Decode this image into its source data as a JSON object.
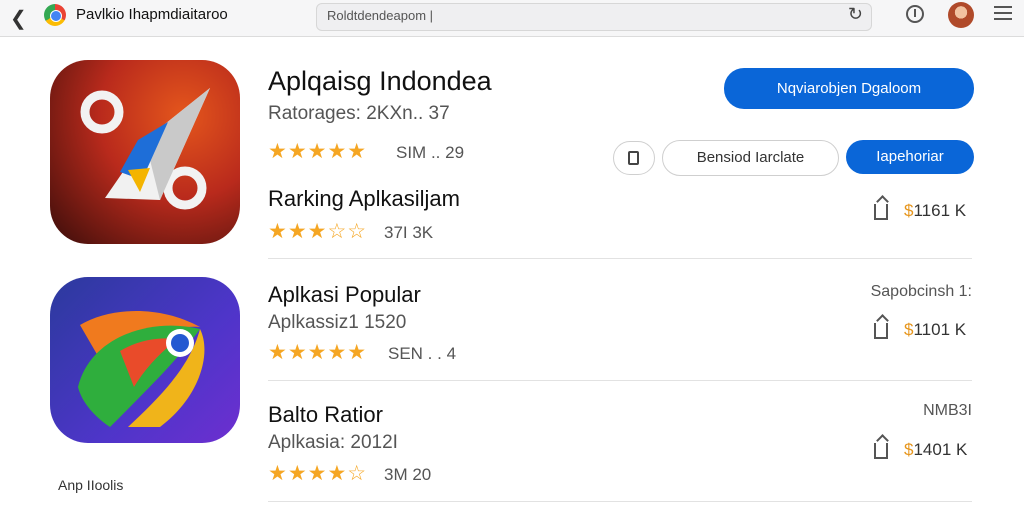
{
  "browser": {
    "back_icon": "chevron-left-icon",
    "tab_title": "Pavlkio Ihapmdiaitaroo",
    "url_text": "Roldtdendeapom |",
    "reload_icon": "reload-icon",
    "info_icon": "info-icon",
    "menu_icon": "menu-icon"
  },
  "featured": {
    "title": "Aplqaisg Indondea",
    "subtitle": "Ratorages: 2KXn.. 37",
    "stars": "★★★★★",
    "rating_meta": "SIM .. 29",
    "primary_button": "Nqviarobjen Dgaloom",
    "icon_name": "compass-app-icon"
  },
  "actions": {
    "clipboard_icon": "clipboard-icon",
    "outline_button": "Bensiod  Iarclate",
    "blue_button": "Iapehoriar"
  },
  "ranking": {
    "title": "Rarking Aplkasiljam",
    "stars": "★★★☆☆",
    "meta": "37I   3K",
    "price_symbol": "$",
    "price": "1161 K"
  },
  "popular": {
    "title": "Aplkasi Popular",
    "subtitle": "Aplkassiz1 1520",
    "stars": "★★★★★",
    "meta": "SEN . . 4",
    "right_label": "Sapobcinsh 1:",
    "price_symbol": "$",
    "price": "1101 K",
    "icon_name": "rocket-app-icon"
  },
  "ballo": {
    "title": "Balto Ratior",
    "subtitle": "Aplkasia: 2012I",
    "stars": "★★★★☆",
    "meta": "3M     20",
    "right_label": "NMB3I",
    "price_symbol": "$",
    "price": "1401 K"
  },
  "footer": {
    "label": "Anp IIoolis"
  },
  "colors": {
    "accent": "#0a66d8",
    "star": "#f5a623",
    "price": "#e6951c"
  }
}
